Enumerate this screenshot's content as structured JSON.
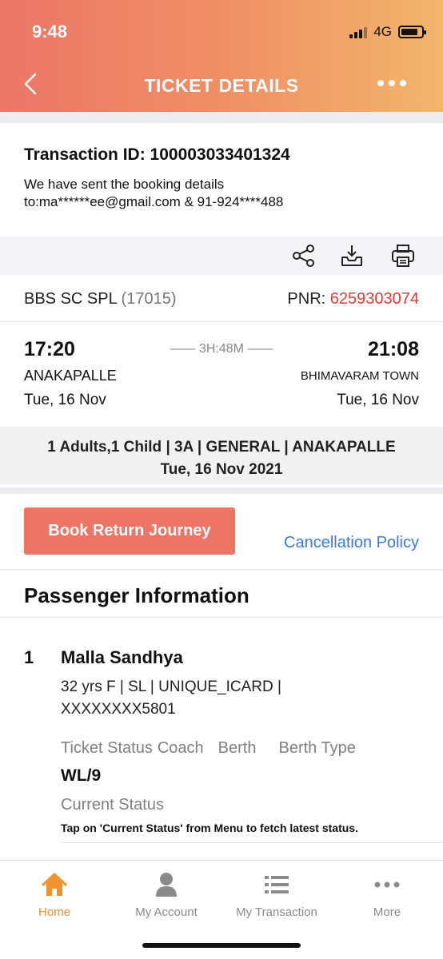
{
  "status_bar": {
    "time": "9:48",
    "network": "4G"
  },
  "header": {
    "title": "TICKET DETAILS"
  },
  "transaction": {
    "id_text": "Transaction ID: 100003033401324",
    "message_line1": "We have sent the booking details",
    "message_line2": "to:ma******ee@gmail.com & 91-924****488"
  },
  "actions": [
    "share-icon",
    "download-icon",
    "print-icon"
  ],
  "train": {
    "name": "BBS SC SPL",
    "number": "(17015)",
    "pnr_label": "PNR:",
    "pnr_value": "6259303074",
    "departure_time": "17:20",
    "arrival_time": "21:08",
    "duration": "—— 3H:48M ——",
    "from_station": "ANAKAPALLE",
    "to_station": "BHIMAVARAM TOWN",
    "departure_date": "Tue, 16 Nov",
    "arrival_date": "Tue, 16 Nov",
    "summary_line1": "1 Adults,1 Child | 3A | GENERAL | ANAKAPALLE",
    "summary_line2": "Tue, 16 Nov 2021"
  },
  "booking": {
    "return_button": "Book Return Journey",
    "cancellation_link": "Cancellation Policy"
  },
  "passengers": {
    "section_title": "Passenger Information",
    "items": [
      {
        "index": "1",
        "name": "Malla Sandhya",
        "details_line1": "32 yrs F | SL | UNIQUE_ICARD |",
        "details_line2": "XXXXXXXX5801",
        "label_ticket_status": "Ticket Status",
        "label_coach": "Coach",
        "label_berth": "Berth",
        "label_berth_type": "Berth Type",
        "ticket_status": "WL/9",
        "current_status_label": "Current Status",
        "current_status_hint": "Tap on 'Current Status' from Menu to fetch latest status."
      }
    ]
  },
  "tabbar": {
    "items": [
      {
        "label": "Home",
        "icon": "home-icon",
        "active": true
      },
      {
        "label": "My Account",
        "icon": "person-icon",
        "active": false
      },
      {
        "label": "My Transaction",
        "icon": "list-icon",
        "active": false
      },
      {
        "label": "More",
        "icon": "more-dots-icon",
        "active": false
      }
    ],
    "active_color": "#f0922f"
  },
  "colors": {
    "header_gradient_start": "#ec7667",
    "header_gradient_end": "#f2b66c",
    "pnr": "#e53935",
    "button": "#ec7565",
    "link": "#3a7bd5"
  }
}
